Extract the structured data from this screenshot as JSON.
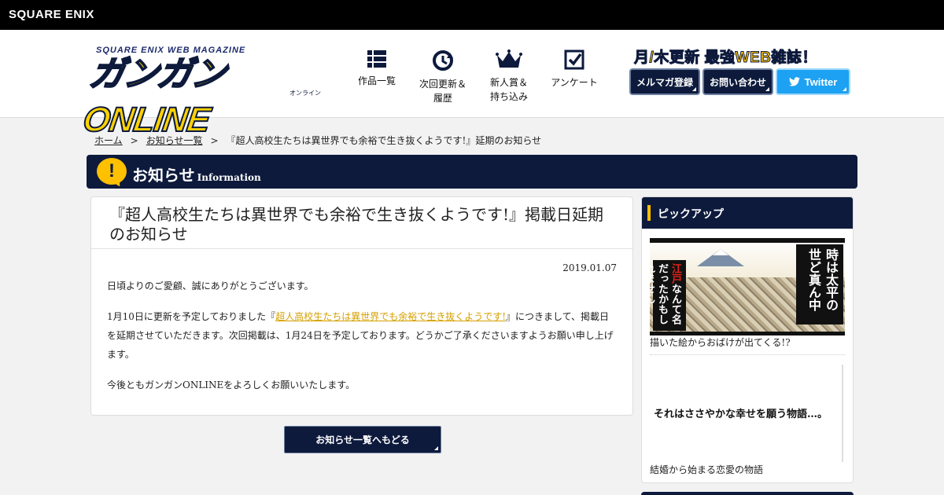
{
  "topbar": {
    "brand": "SQUARE ENIX"
  },
  "header": {
    "logo_sub": "SQUARE ENIX WEB MAGAZINE",
    "logo_main": "ガンガンONLINE",
    "logo_kana": "オンライン",
    "nav": [
      {
        "label": "作品一覧",
        "icon": "grid-icon"
      },
      {
        "label": "次回更新＆\n履歴",
        "icon": "clock-history-icon"
      },
      {
        "label": "新人賞＆\n持ち込み",
        "icon": "crown-icon"
      },
      {
        "label": "アンケート",
        "icon": "checkbox-icon"
      }
    ],
    "tagline": "月/木更新 最強WEB雑誌！",
    "buttons": {
      "mailmag": "メルマガ登録",
      "contact": "お問い合わせ",
      "twitter": "Twitter"
    }
  },
  "breadcrumb": {
    "home": "ホーム",
    "sep": ">",
    "news_list": "お知らせ一覧",
    "current": "『超人高校生たちは異世界でも余裕で生き抜くようです!』延期のお知らせ"
  },
  "banner": {
    "title": "お知らせ",
    "subtitle": "Information",
    "icon": "!"
  },
  "article": {
    "title": "『超人高校生たちは異世界でも余裕で生き抜くようです!』掲載日延期のお知らせ",
    "date": "2019.01.07",
    "p1": "日頃よりのご愛顧、誠にありがとうございます。",
    "p2_before": "1月10日に更新を予定しておりました『",
    "p2_link": "超人高校生たちは異世界でも余裕で生き抜くようです!",
    "p2_after": "』につきまして、掲載日を延期させていただきます。次回掲載は、1月24日を予定しております。どうかご了承くださいますようお願い申し上げます。",
    "p3": "今後ともガンガンONLINEをよろしくお願いいたします。"
  },
  "back_button": "お知らせ一覧へもどる",
  "sidebar": {
    "title": "ピックアップ",
    "pick1": {
      "image_text_left_pre": "",
      "image_text_left_red": "江戸",
      "image_text_left": "なんて名だったかもしれません",
      "image_text_right": "時は太平の世ど真ん中",
      "caption": "描いた絵からおばけが出てくる!?"
    },
    "pick2": {
      "image_text": "それはささやかな幸せを願う物語…。",
      "caption": "結婚から始まる恋愛の物語"
    }
  },
  "colors": {
    "navy": "#0d1a3c",
    "accent_yellow": "#ffc000",
    "twitter_blue": "#1da1f2",
    "link": "#d4a000"
  }
}
